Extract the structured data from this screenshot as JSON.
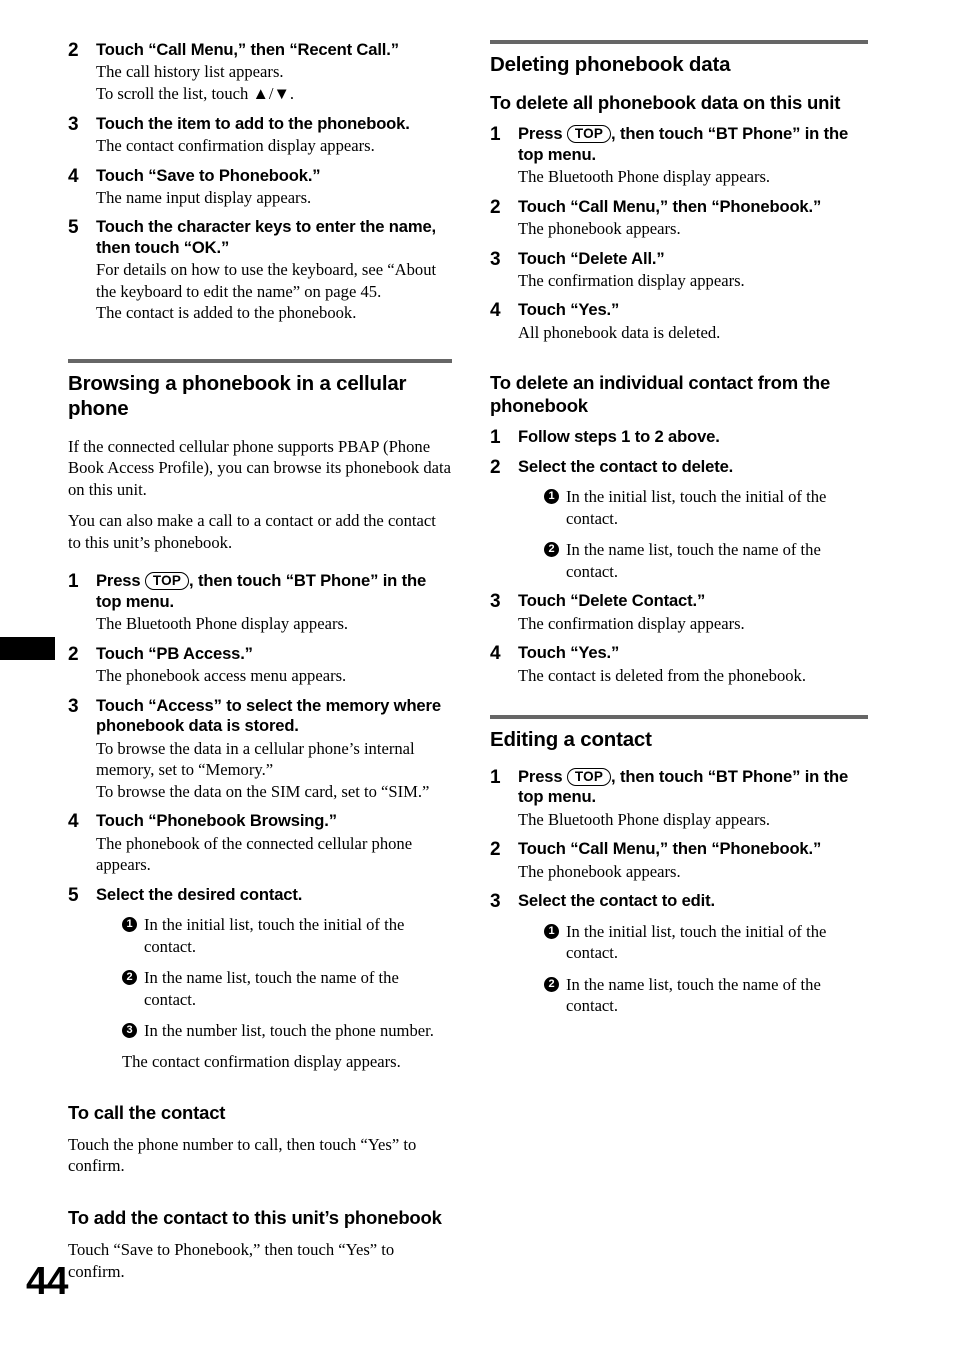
{
  "page": {
    "folio": "44",
    "key_top_label": "TOP"
  },
  "left_column": {
    "steps_continued": [
      {
        "num": "2",
        "head": "Touch “Call Menu,” then “Recent Call.”",
        "body": "The call history list appears.\nTo scroll the list, touch ▲/▼."
      },
      {
        "num": "3",
        "head": "Touch the item to add to the phonebook.",
        "body": "The contact confirmation display appears."
      },
      {
        "num": "4",
        "head": "Touch “Save to Phonebook.”",
        "body": "The name input display appears."
      },
      {
        "num": "5",
        "head": "Touch the character keys to enter the name, then touch “OK.”",
        "body": "For details on how to use the keyboard, see “About the keyboard to edit the name” on page 45.\nThe contact is added to the phonebook."
      }
    ],
    "section": {
      "title": "Browsing a phonebook in a cellular phone",
      "intro_1": "If the connected cellular phone supports PBAP (Phone Book Access Profile), you can browse its phonebook data on this unit.",
      "intro_2": "You can also make a call to a contact or add the contact to this unit’s phonebook.",
      "steps": [
        {
          "num": "1",
          "head_before_key": "Press ",
          "head_after_key": ", then touch “BT Phone” in the top menu.",
          "body": "The Bluetooth Phone display appears."
        },
        {
          "num": "2",
          "head": "Touch “PB Access.”",
          "body": "The phonebook access menu appears."
        },
        {
          "num": "3",
          "head": "Touch “Access” to select the memory where phonebook data is stored.",
          "body": "To browse the data in a cellular phone’s internal memory, set to “Memory.”\nTo browse the data on the SIM card, set to “SIM.”"
        },
        {
          "num": "4",
          "head": "Touch “Phonebook Browsing.”",
          "body": "The phonebook of the connected cellular phone appears."
        },
        {
          "num": "5",
          "head": "Select the desired contact.",
          "substeps": [
            {
              "marker": "1",
              "text": "In the initial list, touch the initial of the contact."
            },
            {
              "marker": "2",
              "text": "In the name list, touch the name of the contact."
            },
            {
              "marker": "3",
              "text": "In the number list, touch the phone number."
            }
          ],
          "after_substeps": "The contact confirmation display appears."
        }
      ]
    },
    "sub_sections": [
      {
        "title": "To call the contact",
        "body": "Touch the phone number to call, then touch “Yes” to confirm."
      },
      {
        "title": "To add the contact to this unit’s phonebook",
        "body": "Touch “Save to Phonebook,” then touch “Yes” to confirm."
      }
    ]
  },
  "right_column": {
    "section_delete": {
      "title": "Deleting phonebook data",
      "sub_all": {
        "title": "To delete all phonebook data on this unit",
        "steps": [
          {
            "num": "1",
            "head_before_key": "Press ",
            "head_after_key": ", then touch “BT Phone” in the top menu.",
            "body": "The Bluetooth Phone display appears."
          },
          {
            "num": "2",
            "head": "Touch “Call Menu,” then “Phonebook.”",
            "body": "The phonebook appears."
          },
          {
            "num": "3",
            "head": "Touch “Delete All.”",
            "body": "The confirmation display appears."
          },
          {
            "num": "4",
            "head": "Touch “Yes.”",
            "body": "All phonebook data is deleted."
          }
        ]
      },
      "sub_individual": {
        "title": "To delete an individual contact from the phonebook",
        "steps": [
          {
            "num": "1",
            "head": "Follow steps 1 to 2 above."
          },
          {
            "num": "2",
            "head": "Select the contact to delete.",
            "substeps": [
              {
                "marker": "1",
                "text": "In the initial list, touch the initial of the contact."
              },
              {
                "marker": "2",
                "text": "In the name list, touch the name of the contact."
              }
            ]
          },
          {
            "num": "3",
            "head": "Touch “Delete Contact.”",
            "body": "The confirmation display appears."
          },
          {
            "num": "4",
            "head": "Touch “Yes.”",
            "body": "The contact is deleted from the phonebook."
          }
        ]
      }
    },
    "section_edit": {
      "title": "Editing a contact",
      "steps": [
        {
          "num": "1",
          "head_before_key": "Press ",
          "head_after_key": ", then touch “BT Phone” in the top menu.",
          "body": "The Bluetooth Phone display appears."
        },
        {
          "num": "2",
          "head": "Touch “Call Menu,” then “Phonebook.”",
          "body": "The phonebook appears."
        },
        {
          "num": "3",
          "head": "Select the contact to edit.",
          "substeps": [
            {
              "marker": "1",
              "text": "In the initial list, touch the initial of the contact."
            },
            {
              "marker": "2",
              "text": "In the name list, touch the name of the contact."
            }
          ]
        }
      ]
    }
  }
}
